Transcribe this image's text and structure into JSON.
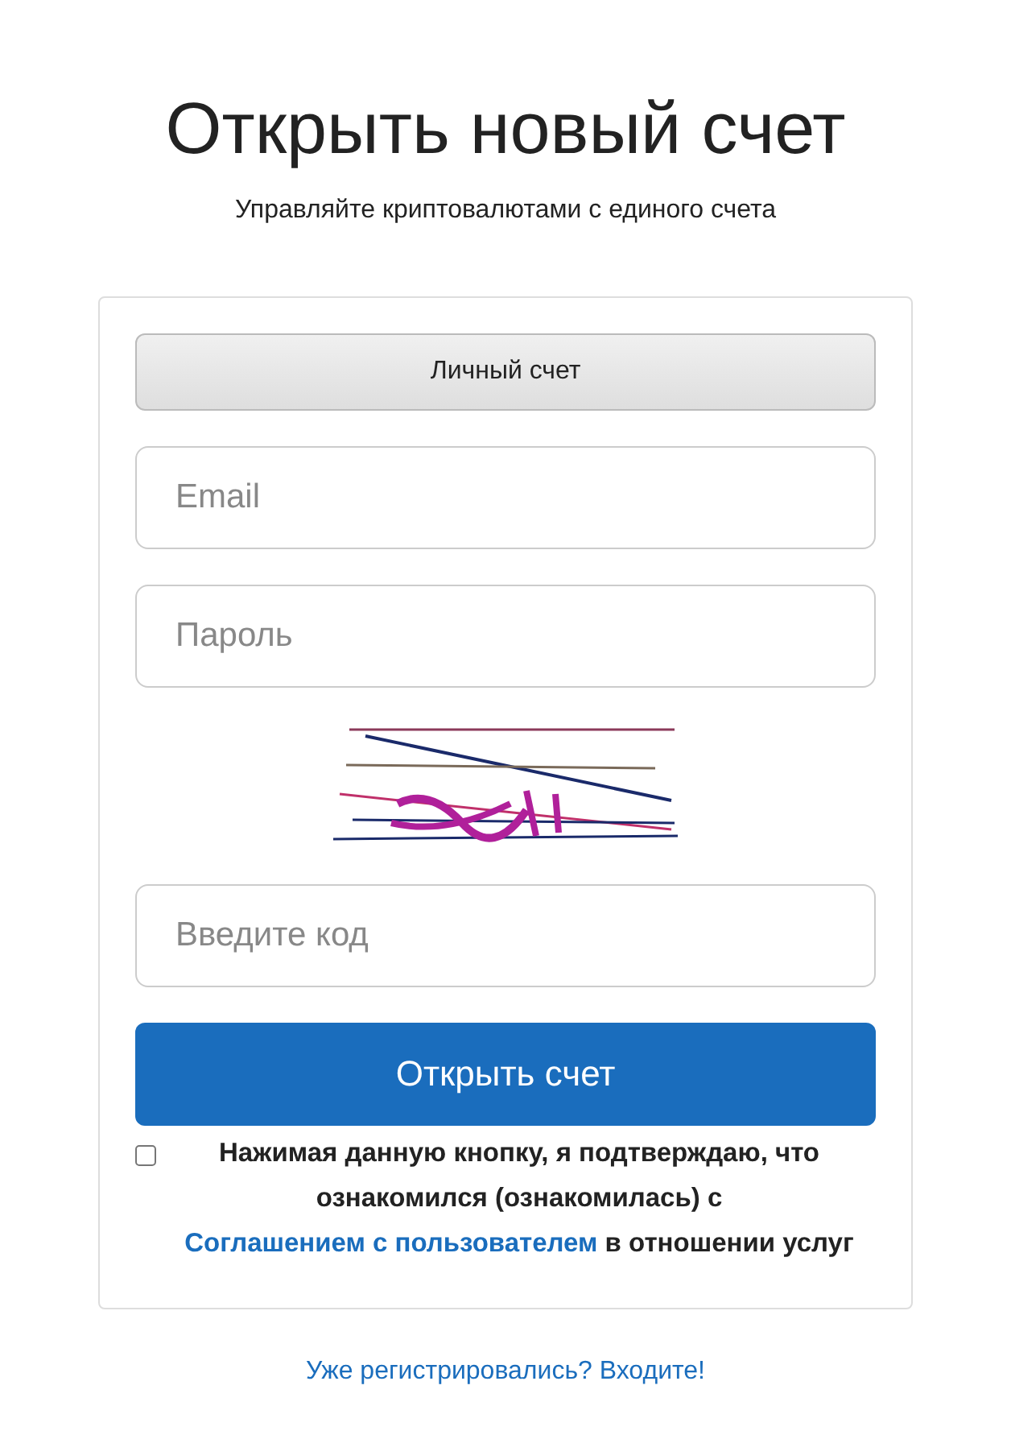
{
  "title": "Открыть новый счет",
  "subtitle": "Управляйте криптовалютами с единого счета",
  "tabs": [
    {
      "label": "Личный счет",
      "selected": true
    }
  ],
  "fields": [
    {
      "placeholder": "Email"
    },
    {
      "placeholder": "Пароль"
    }
  ],
  "code_field": {
    "placeholder": "Введите код"
  },
  "submit": "Открыть счет",
  "agreement": {
    "checked": false,
    "text_before": "Нажимая данную кнопку, я подтверждаю, что ознакомился (ознакомилась) с ",
    "link": "Соглашением с пользователем",
    "text_after": " в отношении услуг"
  },
  "login_link": "Уже регистрировались? Входите!"
}
